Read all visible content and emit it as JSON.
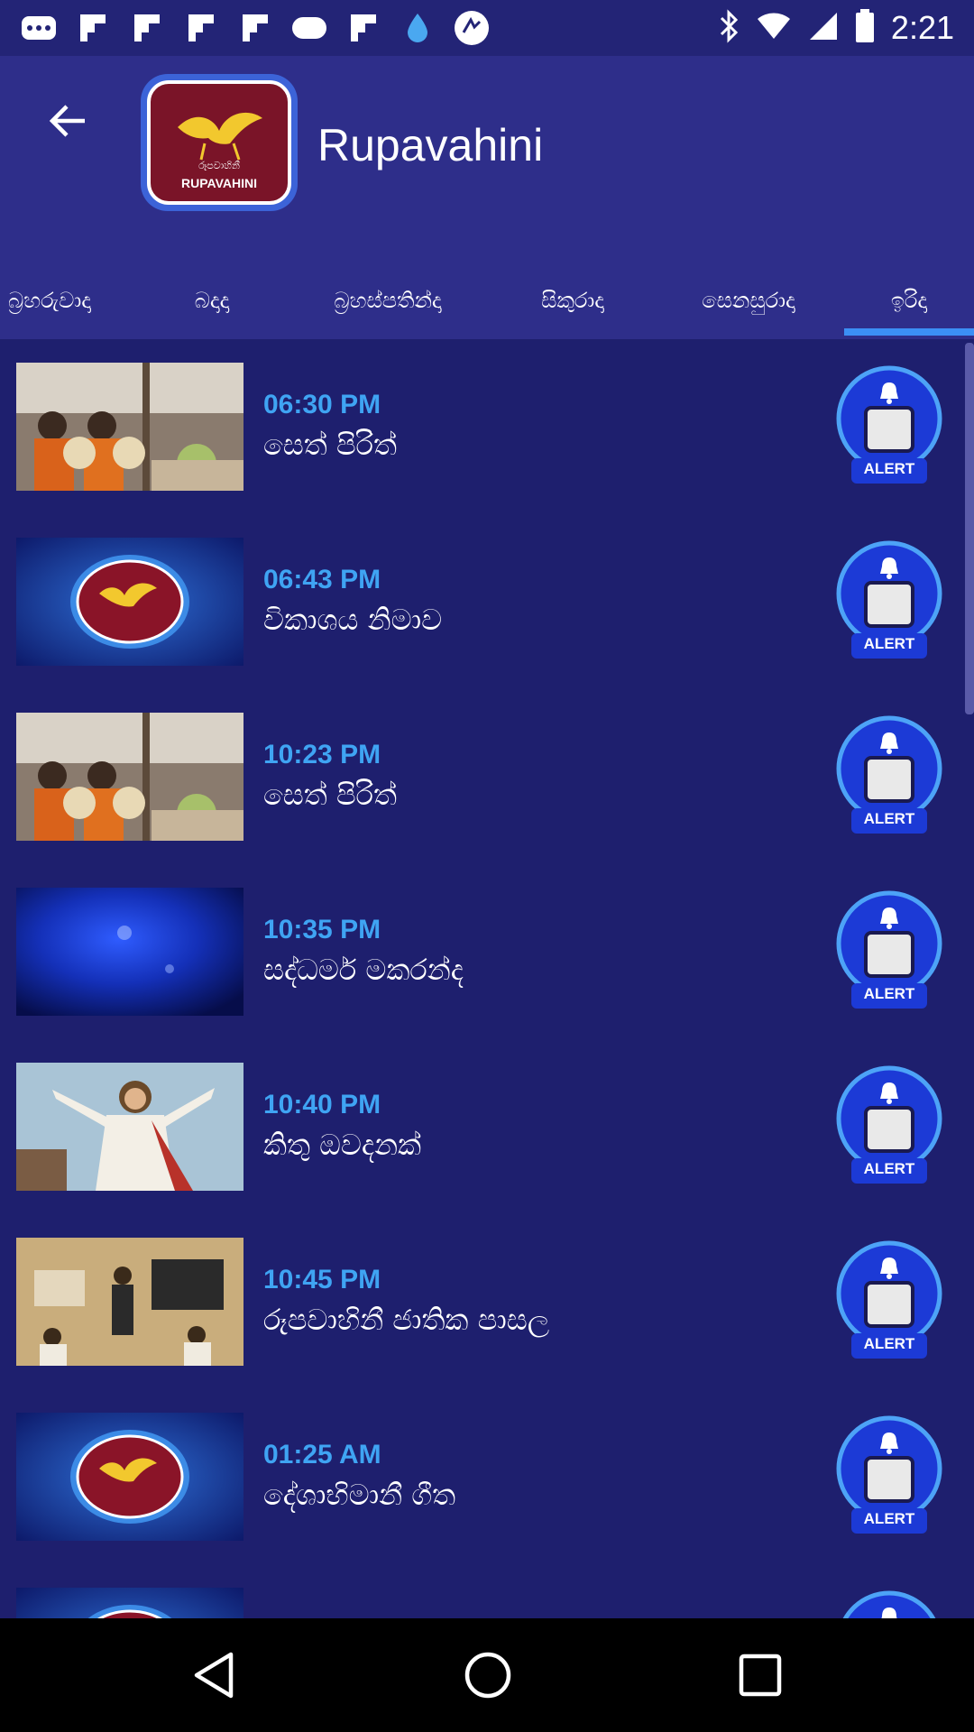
{
  "status_bar": {
    "time": "2:21",
    "left_icons": [
      "messages-icon",
      "flipboard-icon",
      "flipboard-icon",
      "flipboard-icon",
      "flipboard-icon",
      "cloud-icon",
      "flipboard-icon",
      "water-drop-icon",
      "sync-icon"
    ],
    "right_icons": [
      "bluetooth-icon",
      "wifi-icon",
      "signal-icon",
      "battery-icon"
    ]
  },
  "app_bar": {
    "title": "Rupavahini",
    "logo_text": "RUPAVAHINI"
  },
  "tabs": [
    {
      "label": "බ්‍රහරුවාදා"
    },
    {
      "label": "බදාදා"
    },
    {
      "label": "බ්‍රහස්පතින්දා"
    },
    {
      "label": "සිකුරාදා"
    },
    {
      "label": "සෙනසුරාදා"
    },
    {
      "label": "ඉරිදා",
      "selected": true
    }
  ],
  "programs": [
    {
      "time": "06:30 PM",
      "title": "සෙත් පිරිත්",
      "thumb": "monks"
    },
    {
      "time": "06:43 PM",
      "title": "විකාශය නිමාව",
      "thumb": "logo"
    },
    {
      "time": "10:23 PM",
      "title": "සෙත් පිරිත්",
      "thumb": "monks"
    },
    {
      "time": "10:35 PM",
      "title": "සද්ධර්ම මකරන්ද",
      "thumb": "blue"
    },
    {
      "time": "10:40 PM",
      "title": "කිතු ඔවදනක්",
      "thumb": "jesus"
    },
    {
      "time": "10:45 PM",
      "title": "රූපවාහිනී ජාතික පාසල",
      "thumb": "classroom"
    },
    {
      "time": "01:25 AM",
      "title": "දේශාභිමානී ගීත",
      "thumb": "logo"
    },
    {
      "time": "",
      "title": "",
      "thumb": "logo"
    }
  ],
  "alert_label": "ALERT",
  "colors": {
    "background": "#1e1f6e",
    "app_bar": "#2e2e8a",
    "accent": "#3b8ff5",
    "time_text": "#3fa4f3"
  }
}
